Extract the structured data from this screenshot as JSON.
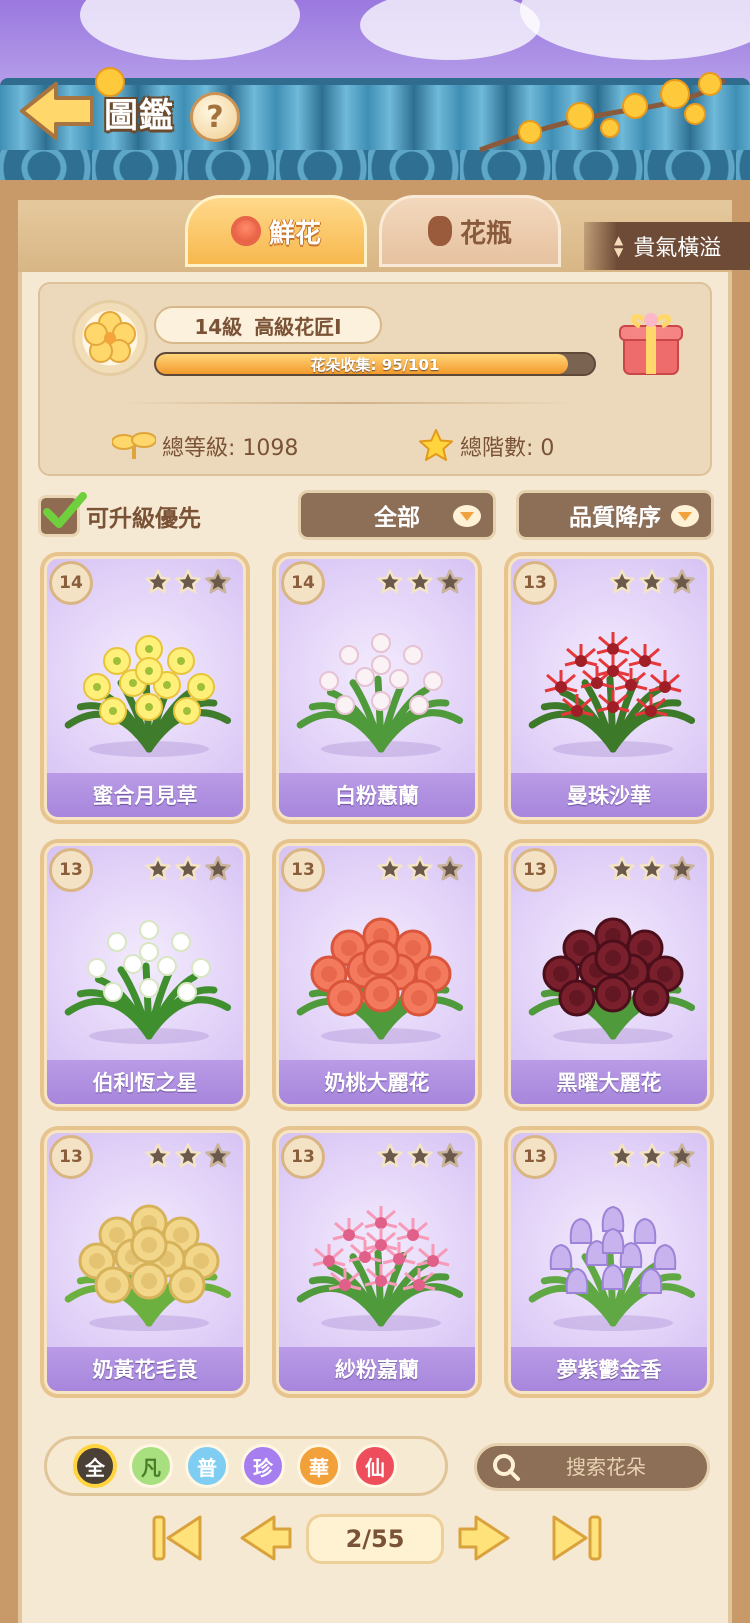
{
  "header": {
    "title": "圖鑑",
    "help_label": "?"
  },
  "tabs": [
    {
      "label": "鮮花",
      "active": true
    },
    {
      "label": "花瓶",
      "active": false
    }
  ],
  "side_banner": {
    "label": "貴氣橫溢"
  },
  "level_card": {
    "level": "14級",
    "rank": "高級花匠Ⅰ",
    "progress_label": "花朵收集: 95/101",
    "progress_fraction": 0.94,
    "total_level_label": "總等級: 1098",
    "total_tier_label": "總階數: 0"
  },
  "filters": {
    "upgrade_first_label": "可升級優先",
    "upgrade_first_checked": true,
    "category_value": "全部",
    "sort_value": "品質降序"
  },
  "cards": [
    {
      "level": "14",
      "name": "蜜合月見草",
      "stars_filled": 2,
      "plant": "yellow-primrose"
    },
    {
      "level": "14",
      "name": "白粉蕙蘭",
      "stars_filled": 2,
      "plant": "white-orchid"
    },
    {
      "level": "13",
      "name": "曼珠沙華",
      "stars_filled": 2,
      "plant": "red-spider-lily"
    },
    {
      "level": "13",
      "name": "伯利恆之星",
      "stars_filled": 2,
      "plant": "white-star"
    },
    {
      "level": "13",
      "name": "奶桃大麗花",
      "stars_filled": 2,
      "plant": "peach-dahlia"
    },
    {
      "level": "13",
      "name": "黑曜大麗花",
      "stars_filled": 2,
      "plant": "dark-dahlia"
    },
    {
      "level": "13",
      "name": "奶黃花毛茛",
      "stars_filled": 2,
      "plant": "yellow-ranunculus"
    },
    {
      "level": "13",
      "name": "紗粉嘉蘭",
      "stars_filled": 2,
      "plant": "pink-gloriosa"
    },
    {
      "level": "13",
      "name": "夢紫鬱金香",
      "stars_filled": 2,
      "plant": "purple-tulip"
    }
  ],
  "rarity_filters": [
    {
      "label": "全",
      "color": "#4a4036",
      "text_color": "#ffffff",
      "selected": true
    },
    {
      "label": "凡",
      "color": "#a9e07f",
      "text_color": "#4b7d2a",
      "selected": false
    },
    {
      "label": "普",
      "color": "#7fcdf2",
      "text_color": "#ffffff",
      "selected": false
    },
    {
      "label": "珍",
      "color": "#a77ef0",
      "text_color": "#ffffff",
      "selected": false
    },
    {
      "label": "華",
      "color": "#f2a13a",
      "text_color": "#ffffff",
      "selected": false
    },
    {
      "label": "仙",
      "color": "#ee4d5c",
      "text_color": "#ffffff",
      "selected": false
    }
  ],
  "search": {
    "placeholder": "搜索花朵"
  },
  "pager": {
    "label": "2/55"
  },
  "colors": {
    "accent_orange": "#f7b84e",
    "card_purple": "#a786dc",
    "panel_brown": "#8d6e57"
  }
}
